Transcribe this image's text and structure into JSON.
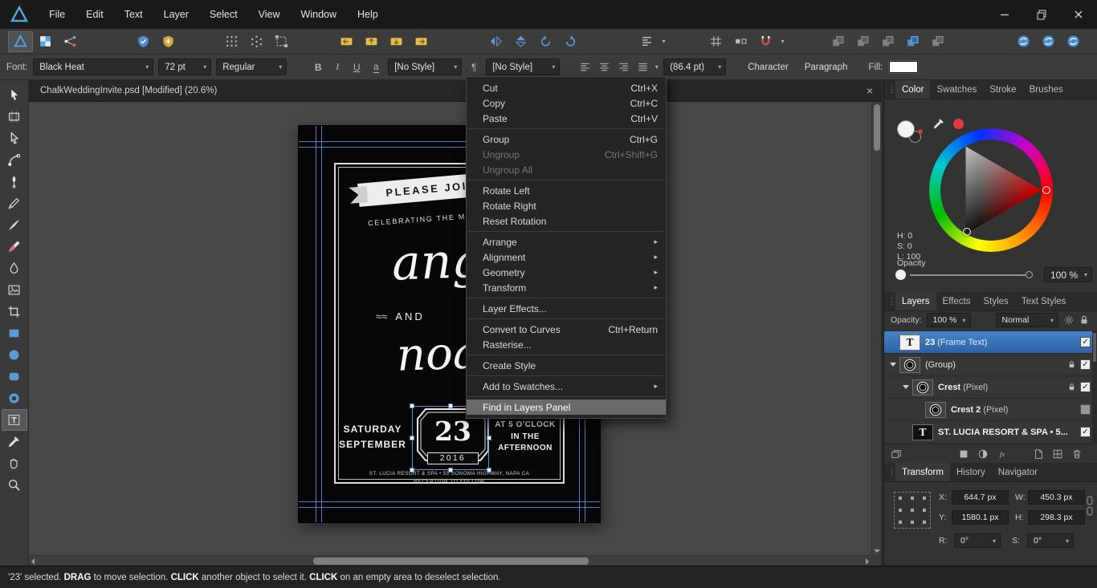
{
  "menubar": {
    "items": [
      "File",
      "Edit",
      "Text",
      "Layer",
      "Select",
      "View",
      "Window",
      "Help"
    ]
  },
  "doc_tab": {
    "title": "ChalkWeddingInvite.psd [Modified] (20.6%)"
  },
  "context_toolbar": {
    "font_label": "Font:",
    "font_name": "Black Heat",
    "font_size": "72 pt",
    "font_style": "Regular",
    "bold": "B",
    "italic": "I",
    "underline": "U",
    "underline_a": "a",
    "char_style": "[No Style]",
    "pilcrow": "¶",
    "para_style": "[No Style]",
    "leading": "(86.4 pt)",
    "character": "Character",
    "paragraph": "Paragraph",
    "fill_label": "Fill:"
  },
  "toolbar": {
    "groups": [
      {
        "name": "personas",
        "gap": 10,
        "items": [
          {
            "icon": "persona-designer",
            "active": true
          },
          {
            "icon": "persona-pixel"
          },
          {
            "icon": "persona-export"
          }
        ]
      },
      {
        "name": "badges",
        "gap": 60,
        "items": [
          {
            "icon": "badge-blue"
          },
          {
            "icon": "badge-gold"
          }
        ]
      },
      {
        "name": "grids",
        "gap": 48,
        "items": [
          {
            "icon": "grid-dots"
          },
          {
            "icon": "grid-iso"
          },
          {
            "icon": "transform-box"
          }
        ]
      },
      {
        "name": "insertion",
        "gap": 50,
        "items": [
          {
            "icon": "insert-behind"
          },
          {
            "icon": "insert-top"
          },
          {
            "icon": "insert-inside"
          },
          {
            "icon": "insert-replace"
          }
        ]
      },
      {
        "name": "flip-rotate",
        "gap": 62,
        "items": [
          {
            "icon": "flip-h"
          },
          {
            "icon": "flip-v"
          },
          {
            "icon": "rotate-ccw"
          },
          {
            "icon": "rotate-cw"
          }
        ]
      },
      {
        "name": "alignment",
        "gap": 64,
        "items": [
          {
            "icon": "alignment",
            "caret": true
          }
        ]
      },
      {
        "name": "snapping",
        "gap": 44,
        "items": [
          {
            "icon": "grid-toggle"
          },
          {
            "icon": "pixel-align"
          },
          {
            "icon": "magnet",
            "caret": true
          }
        ]
      },
      {
        "name": "arrange",
        "gap": 48,
        "items": [
          {
            "icon": "arrange-gray"
          },
          {
            "icon": "arrange-gray"
          },
          {
            "icon": "arrange-gray"
          },
          {
            "icon": "arrange-blue"
          },
          {
            "icon": "arrange-gray"
          }
        ]
      },
      {
        "name": "assets",
        "gap": "auto",
        "pad_right": 14,
        "items": [
          {
            "icon": "orb"
          },
          {
            "icon": "orb"
          },
          {
            "icon": "orb"
          }
        ]
      }
    ]
  },
  "tools": {
    "items": [
      {
        "icon": "move-tool"
      },
      {
        "icon": "artboard-tool"
      },
      {
        "icon": "node-tool"
      },
      {
        "icon": "corner-tool"
      },
      {
        "icon": "pen-tool"
      },
      {
        "icon": "pencil-tool"
      },
      {
        "icon": "vector-brush-tool"
      },
      {
        "icon": "paint-brush-tool"
      },
      {
        "icon": "fill-tool"
      },
      {
        "icon": "place-image-tool"
      },
      {
        "icon": "crop-tool"
      },
      {
        "icon": "rectangle-tool"
      },
      {
        "icon": "ellipse-tool"
      },
      {
        "icon": "rounded-rectangle-tool"
      },
      {
        "icon": "shape-tool"
      },
      {
        "icon": "frame-text-tool",
        "active": true
      },
      {
        "icon": "colour-picker-tool"
      },
      {
        "icon": "view-tool"
      },
      {
        "icon": "zoom-tool"
      }
    ]
  },
  "context_menu": {
    "items": [
      {
        "label": "Cut",
        "shortcut": "Ctrl+X"
      },
      {
        "label": "Copy",
        "shortcut": "Ctrl+C"
      },
      {
        "label": "Paste",
        "shortcut": "Ctrl+V"
      },
      {
        "sep": true
      },
      {
        "label": "Group",
        "shortcut": "Ctrl+G"
      },
      {
        "label": "Ungroup",
        "shortcut": "Ctrl+Shift+G",
        "disabled": true
      },
      {
        "label": "Ungroup All",
        "disabled": true
      },
      {
        "sep": true
      },
      {
        "label": "Rotate Left"
      },
      {
        "label": "Rotate Right"
      },
      {
        "label": "Reset Rotation"
      },
      {
        "sep": true
      },
      {
        "label": "Arrange",
        "submenu": true
      },
      {
        "label": "Alignment",
        "submenu": true
      },
      {
        "label": "Geometry",
        "submenu": true
      },
      {
        "label": "Transform",
        "submenu": true
      },
      {
        "sep": true
      },
      {
        "label": "Layer Effects..."
      },
      {
        "sep": true
      },
      {
        "label": "Convert to Curves",
        "shortcut": "Ctrl+Return"
      },
      {
        "label": "Rasterise..."
      },
      {
        "sep": true
      },
      {
        "label": "Create Style"
      },
      {
        "sep": true
      },
      {
        "label": "Add to Swatches...",
        "submenu": true
      },
      {
        "sep": true
      },
      {
        "label": "Find in Layers Panel",
        "highlight": true
      }
    ]
  },
  "invite": {
    "ribbon": "PLEASE JOIN",
    "celebrating": "CELEBRATING THE M",
    "name1": "ange",
    "and": "AND",
    "name2": "noa",
    "day_label_1": "SATURDAY",
    "day_label_2": "SEPTEMBER",
    "day_number": "23",
    "year": "2016",
    "time_1": "AT 5 O'CLOCK",
    "time_2": "IN THE",
    "time_3": "AFTERNOON",
    "address": "ST. LUCIA RESORT & SPA • 55 SONOMA HIGHWAY, NAPA CA",
    "reception": "RECEPTION TO FOLLOW"
  },
  "color_panel": {
    "tabs": [
      "Color",
      "Swatches",
      "Stroke",
      "Brushes"
    ],
    "h": "H: 0",
    "s": "S: 0",
    "l": "L: 100",
    "opacity_label": "Opacity",
    "opacity_value": "100 %",
    "accent_red": "#e03c3c"
  },
  "layers_panel": {
    "tabs": [
      "Layers",
      "Effects",
      "Styles",
      "Text Styles"
    ],
    "opacity_label": "Opacity:",
    "opacity_value": "100 %",
    "blend": "Normal",
    "rows": [
      {
        "name": "23",
        "suffix": "(Frame Text)",
        "selected": true,
        "thumb": "text-light",
        "indent": 0,
        "checked": true,
        "bold": true
      },
      {
        "name": "(Group)",
        "suffix": "",
        "thumb": "crest",
        "indent": 0,
        "expander": true,
        "locked": true,
        "checked": true,
        "bold": false
      },
      {
        "name": "Crest",
        "suffix": "(Pixel)",
        "thumb": "crest",
        "indent": 1,
        "expander": true,
        "locked": true,
        "checked": true,
        "bold": true
      },
      {
        "name": "Crest 2",
        "suffix": "(Pixel)",
        "thumb": "crest",
        "indent": 2,
        "checked": "dim",
        "bold": true
      },
      {
        "name": "ST. LUCIA RESORT & SPA • 5...",
        "suffix": "",
        "thumb": "text-dark",
        "indent": 1,
        "checked": true,
        "bold": true
      }
    ],
    "footer_icons": [
      {
        "icon": "stack"
      },
      {
        "icon": "solid-square",
        "ml": 60
      },
      {
        "icon": "adjustment"
      },
      {
        "icon": "fx"
      },
      {
        "icon": "new-page",
        "ml": "auto"
      },
      {
        "icon": "new-grid"
      },
      {
        "icon": "trash"
      }
    ]
  },
  "transform_panel": {
    "tabs": [
      "Transform",
      "History",
      "Navigator"
    ],
    "fields": [
      {
        "label": "X:",
        "value": "644.7 px"
      },
      {
        "label": "W:",
        "value": "450.3 px"
      },
      {
        "label": "Y:",
        "value": "1580.1 px"
      },
      {
        "label": "H:",
        "value": "298.3 px"
      }
    ],
    "r_label": "R:",
    "r_value": "0°",
    "s_label": "S:",
    "s_value": "0°"
  },
  "status": {
    "segments": [
      {
        "text": "'23' selected. "
      },
      {
        "text": "DRAG",
        "bold": true
      },
      {
        "text": " to move selection. "
      },
      {
        "text": "CLICK",
        "bold": true
      },
      {
        "text": " another object to select it. "
      },
      {
        "text": "CLICK",
        "bold": true
      },
      {
        "text": " on an empty area to deselect selection."
      }
    ]
  }
}
